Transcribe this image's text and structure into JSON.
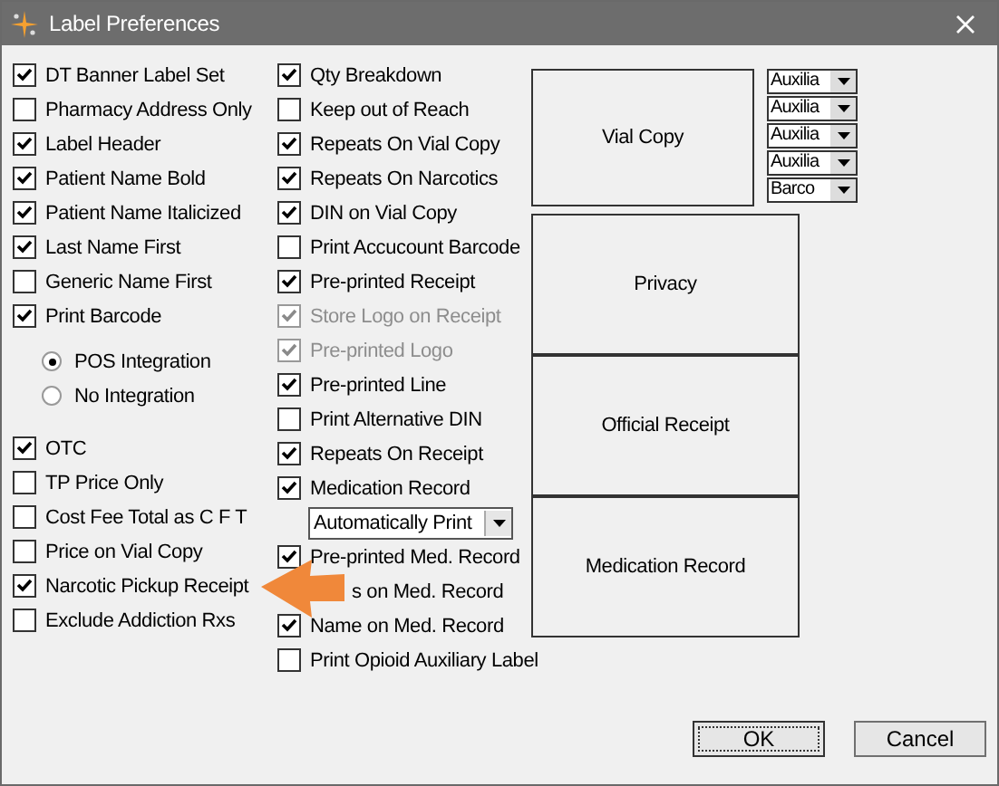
{
  "window": {
    "title": "Label Preferences"
  },
  "left_options": [
    {
      "kind": "checkbox",
      "label": "DT Banner Label Set",
      "checked": true,
      "disabled": false
    },
    {
      "kind": "checkbox",
      "label": "Pharmacy Address Only",
      "checked": false,
      "disabled": false
    },
    {
      "kind": "checkbox",
      "label": "Label Header",
      "checked": true,
      "disabled": false
    },
    {
      "kind": "checkbox",
      "label": "Patient Name Bold",
      "checked": true,
      "disabled": false
    },
    {
      "kind": "checkbox",
      "label": "Patient Name Italicized",
      "checked": true,
      "disabled": false
    },
    {
      "kind": "checkbox",
      "label": "Last Name First",
      "checked": true,
      "disabled": false
    },
    {
      "kind": "checkbox",
      "label": "Generic Name First",
      "checked": false,
      "disabled": false
    },
    {
      "kind": "checkbox",
      "label": "Print Barcode",
      "checked": true,
      "disabled": false
    },
    {
      "kind": "radio",
      "label": "POS Integration",
      "selected": true,
      "disabled": false
    },
    {
      "kind": "radio",
      "label": "No Integration",
      "selected": false,
      "disabled": false
    },
    {
      "kind": "checkbox",
      "label": "OTC",
      "checked": true,
      "disabled": false
    },
    {
      "kind": "checkbox",
      "label": "TP Price Only",
      "checked": false,
      "disabled": false
    },
    {
      "kind": "checkbox",
      "label": "Cost Fee Total as C F T",
      "checked": false,
      "disabled": false
    },
    {
      "kind": "checkbox",
      "label": "Price on Vial Copy",
      "checked": false,
      "disabled": false
    },
    {
      "kind": "checkbox",
      "label": "Narcotic Pickup Receipt",
      "checked": true,
      "disabled": false
    },
    {
      "kind": "checkbox",
      "label": "Exclude Addiction Rxs",
      "checked": false,
      "disabled": false
    }
  ],
  "middle_options": [
    {
      "kind": "checkbox",
      "label": "Qty Breakdown",
      "checked": true,
      "disabled": false
    },
    {
      "kind": "checkbox",
      "label": "Keep out of Reach",
      "checked": false,
      "disabled": false
    },
    {
      "kind": "checkbox",
      "label": "Repeats On Vial Copy",
      "checked": true,
      "disabled": false
    },
    {
      "kind": "checkbox",
      "label": "Repeats On Narcotics",
      "checked": true,
      "disabled": false
    },
    {
      "kind": "checkbox",
      "label": "DIN on Vial Copy",
      "checked": true,
      "disabled": false
    },
    {
      "kind": "checkbox",
      "label": "Print Accucount Barcode",
      "checked": false,
      "disabled": false
    },
    {
      "kind": "checkbox",
      "label": "Pre-printed Receipt",
      "checked": true,
      "disabled": false
    },
    {
      "kind": "checkbox",
      "label": "Store Logo on Receipt",
      "checked": true,
      "disabled": true
    },
    {
      "kind": "checkbox",
      "label": "Pre-printed Logo",
      "checked": true,
      "disabled": true
    },
    {
      "kind": "checkbox",
      "label": "Pre-printed Line",
      "checked": true,
      "disabled": false
    },
    {
      "kind": "checkbox",
      "label": "Print Alternative DIN",
      "checked": false,
      "disabled": false
    },
    {
      "kind": "checkbox",
      "label": "Repeats On Receipt",
      "checked": true,
      "disabled": false
    },
    {
      "kind": "checkbox",
      "label": "Medication Record",
      "checked": true,
      "disabled": false
    },
    {
      "kind": "dropdown",
      "value": "Automatically Print"
    },
    {
      "kind": "checkbox",
      "label": "Pre-printed Med. Record",
      "checked": true,
      "disabled": false
    },
    {
      "kind": "covered",
      "label": "s on Med. Record"
    },
    {
      "kind": "checkbox",
      "label": "Name on Med. Record",
      "checked": true,
      "disabled": false
    },
    {
      "kind": "checkbox",
      "label": "Print Opioid Auxiliary Label",
      "checked": false,
      "disabled": false
    }
  ],
  "print_sections": [
    {
      "label": "Vial Copy"
    },
    {
      "label": "Privacy"
    },
    {
      "label": "Official Receipt"
    },
    {
      "label": "Medication Record"
    }
  ],
  "vial_dropdowns": [
    {
      "value": "Auxilia"
    },
    {
      "value": "Auxilia"
    },
    {
      "value": "Auxilia"
    },
    {
      "value": "Auxilia"
    },
    {
      "value": "Barco"
    }
  ],
  "buttons": [
    {
      "label": "OK",
      "default": true
    },
    {
      "label": "Cancel",
      "default": false
    }
  ]
}
